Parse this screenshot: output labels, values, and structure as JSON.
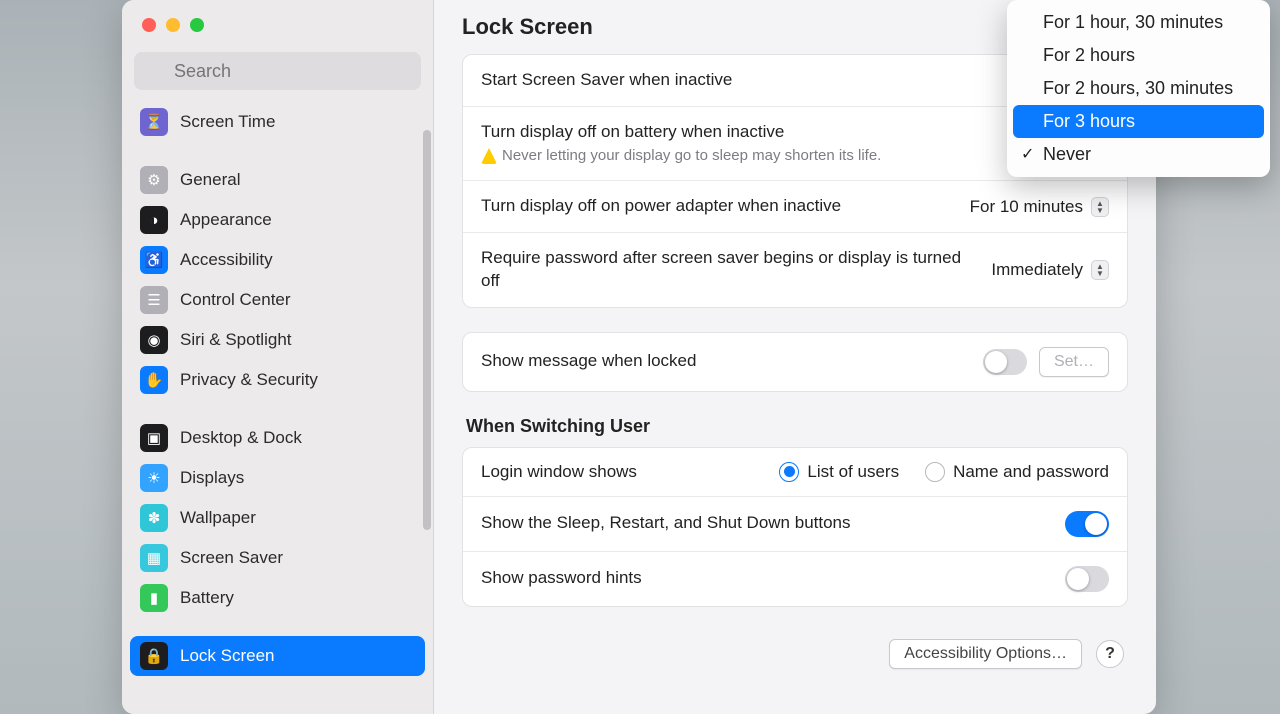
{
  "search_placeholder": "Search",
  "page_title": "Lock Screen",
  "sidebar": {
    "groups": [
      [
        {
          "label": "Screen Time",
          "icon_bg": "#6f65d1",
          "icon_name": "hourglass-icon",
          "glyph": "⏳"
        }
      ],
      [
        {
          "label": "General",
          "icon_bg": "#b0b0b6",
          "icon_name": "gear-icon",
          "glyph": "⚙"
        },
        {
          "label": "Appearance",
          "icon_bg": "#1d1d1f",
          "icon_name": "appearance-icon",
          "glyph": "◑"
        },
        {
          "label": "Accessibility",
          "icon_bg": "#0a7aff",
          "icon_name": "accessibility-icon",
          "glyph": "♿"
        },
        {
          "label": "Control Center",
          "icon_bg": "#b0b0b6",
          "icon_name": "sliders-icon",
          "glyph": "☰"
        },
        {
          "label": "Siri & Spotlight",
          "icon_bg": "#1d1d1f",
          "icon_name": "siri-icon",
          "glyph": "◉"
        },
        {
          "label": "Privacy & Security",
          "icon_bg": "#0a7aff",
          "icon_name": "hand-icon",
          "glyph": "✋"
        }
      ],
      [
        {
          "label": "Desktop & Dock",
          "icon_bg": "#1d1d1f",
          "icon_name": "dock-icon",
          "glyph": "▣"
        },
        {
          "label": "Displays",
          "icon_bg": "#32a4ff",
          "icon_name": "brightness-icon",
          "glyph": "☀"
        },
        {
          "label": "Wallpaper",
          "icon_bg": "#2fc6d8",
          "icon_name": "wallpaper-icon",
          "glyph": "✽"
        },
        {
          "label": "Screen Saver",
          "icon_bg": "#37c8de",
          "icon_name": "screensaver-icon",
          "glyph": "▦"
        },
        {
          "label": "Battery",
          "icon_bg": "#34c759",
          "icon_name": "battery-icon",
          "glyph": "▮"
        }
      ],
      [
        {
          "label": "Lock Screen",
          "icon_bg": "#1d1d1f",
          "icon_name": "lock-icon",
          "glyph": "🔒",
          "selected": true
        }
      ]
    ]
  },
  "panel1": {
    "row1_label": "Start Screen Saver when inactive",
    "row2_label": "Turn display off on battery when inactive",
    "row2_sub": "Never letting your display go to sleep may shorten its life.",
    "row3_label": "Turn display off on power adapter when inactive",
    "row3_value": "For 10 minutes",
    "row4_label": "Require password after screen saver begins or display is turned off",
    "row4_value": "Immediately"
  },
  "panel2": {
    "row1_label": "Show message when locked",
    "row1_toggle": false,
    "row1_btn": "Set…"
  },
  "section_heading": "When Switching User",
  "panel3": {
    "row1_label": "Login window shows",
    "row1_opt1": "List of users",
    "row1_opt2": "Name and password",
    "row1_selected": "opt1",
    "row2_label": "Show the Sleep, Restart, and Shut Down buttons",
    "row2_toggle": true,
    "row3_label": "Show password hints",
    "row3_toggle": false
  },
  "footer_btn": "Accessibility Options…",
  "dropdown": {
    "items": [
      {
        "label": "For 1 hour, 30 minutes"
      },
      {
        "label": "For 2 hours"
      },
      {
        "label": "For 2 hours, 30 minutes"
      },
      {
        "label": "For 3 hours",
        "selected": true
      },
      {
        "label": "Never",
        "checked": true
      }
    ]
  }
}
